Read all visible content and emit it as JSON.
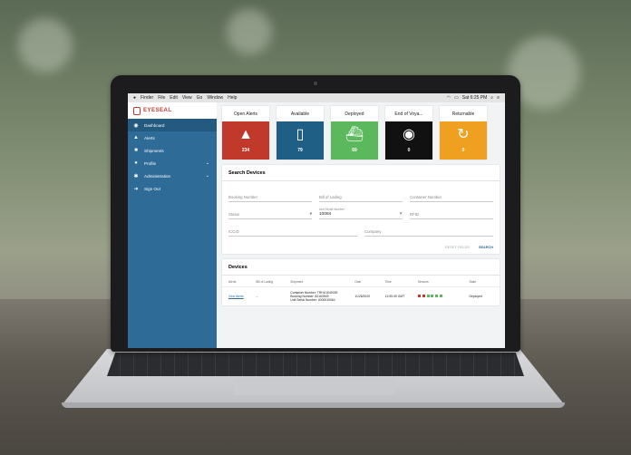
{
  "menubar": {
    "apple": "",
    "items": [
      "Finder",
      "File",
      "Edit",
      "View",
      "Go",
      "Window",
      "Help"
    ],
    "clock": "Sat 6:25 PM"
  },
  "brand": {
    "name": "EYESEAL"
  },
  "sidebar": {
    "items": [
      {
        "label": "Dashboard",
        "icon": "eye-icon"
      },
      {
        "label": "Alerts",
        "icon": "warning-icon"
      },
      {
        "label": "Shipments",
        "icon": "truck-icon"
      },
      {
        "label": "Profile",
        "icon": "user-icon"
      },
      {
        "label": "Administration",
        "icon": "gear-icon"
      },
      {
        "label": "Sign Out",
        "icon": "logout-icon"
      }
    ]
  },
  "cards": [
    {
      "title": "Open Alerts",
      "count": "234",
      "color": "#c0392b",
      "glyph": "▲"
    },
    {
      "title": "Available",
      "count": "79",
      "color": "#1f5f85",
      "glyph": "▯"
    },
    {
      "title": "Deployed",
      "count": "69",
      "color": "#5cb85c",
      "glyph": "⛴"
    },
    {
      "title": "End of Voya...",
      "count": "0",
      "color": "#111111",
      "glyph": "◉"
    },
    {
      "title": "Returnable",
      "count": "0",
      "color": "#f0a020",
      "glyph": "↻"
    }
  ],
  "search": {
    "title": "Search Devices",
    "booking_placeholder": "Booking Number",
    "bol_placeholder": "Bill of Lading",
    "container_placeholder": "Container Number",
    "status_placeholder": "Status",
    "serial_label": "Unit Serial Number",
    "serial_value": "10064",
    "rfid_placeholder": "RFID",
    "iccid_placeholder": "ICCID",
    "company_placeholder": "Company",
    "reset_label": "RESET FIELDS",
    "search_label": "SEARCH"
  },
  "devices": {
    "title": "Devices",
    "headers": [
      "Alerts",
      "Bill of Lading",
      "Shipment",
      "Date",
      "Time",
      "Sensors",
      "State"
    ],
    "row": {
      "alerts": "View Alerts",
      "bol": "--",
      "shipment_line1": "Container Number: TRHU1040039",
      "shipment_line2": "Booking Number: 82163949",
      "shipment_line3": "Unit Serial Number: 4000010064",
      "date": "11/26/2020",
      "time": "12:05:49 GMT",
      "state": "Deployed"
    }
  }
}
